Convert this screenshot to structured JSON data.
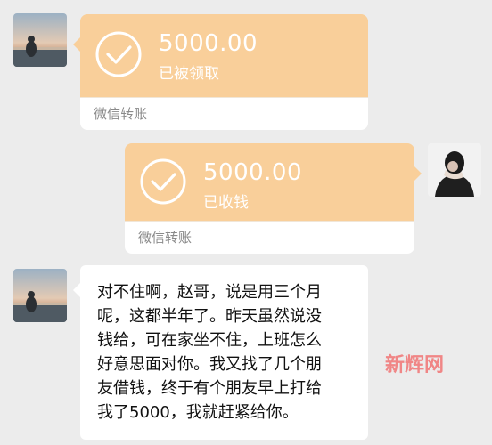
{
  "chat": {
    "transfer1": {
      "amount": "5000.00",
      "status": "已被领取",
      "label": "微信转账"
    },
    "transfer2": {
      "amount": "5000.00",
      "status": "已收钱",
      "label": "微信转账"
    },
    "message": {
      "lines": [
        "对不住啊，赵哥，说是用三个月",
        "呢，这都半年了。昨天虽然说没",
        "钱给，可在家坐不住，上班怎么",
        "好意思面对你。我又找了几个朋",
        "友借钱，终于有个朋友早上打给",
        "我了5000，我就赶紧给你。"
      ]
    },
    "watermark": "新辉网"
  },
  "colors": {
    "transfer_bg": "#f9cf9a",
    "chat_bg": "#ececec",
    "bubble_bg": "#ffffff",
    "watermark": "#f26a6a"
  },
  "icons": {
    "check": "check-circle-icon",
    "avatar_left": "beach-sunset-avatar",
    "avatar_right": "person-avatar"
  }
}
